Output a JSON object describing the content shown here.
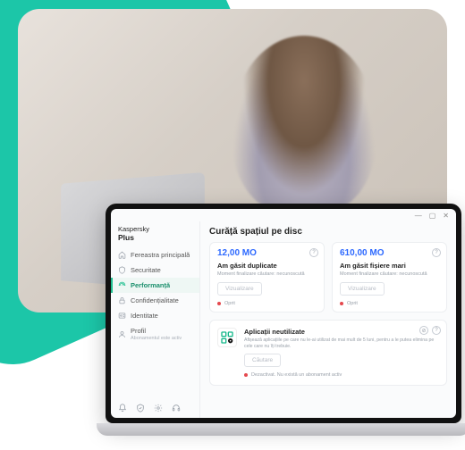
{
  "brand": {
    "line1": "Kaspersky",
    "line2": "Plus"
  },
  "window": {
    "min": "—",
    "max": "▢",
    "close": "✕"
  },
  "sidebar": {
    "items": [
      {
        "icon": "home-icon",
        "label": "Fereastra principală"
      },
      {
        "icon": "shield-icon",
        "label": "Securitate"
      },
      {
        "icon": "gauge-icon",
        "label": "Performanță"
      },
      {
        "icon": "lock-icon",
        "label": "Confidențialitate"
      },
      {
        "icon": "id-icon",
        "label": "Identitate"
      },
      {
        "icon": "user-icon",
        "label": "Profil",
        "sub": "Abonamentul este activ"
      }
    ],
    "bottom": {
      "bell": "bell-icon",
      "shield": "shield-check-icon",
      "gear": "gear-icon",
      "headset": "headset-icon"
    }
  },
  "main": {
    "title": "Curăță spațiul pe disc",
    "cards": {
      "duplicates": {
        "metric": "12,00 MO",
        "title": "Am găsit duplicate",
        "desc": "Moment finalizare căutare: necunoscută",
        "view_label": "Vizualizare",
        "status": "Oprit",
        "help_glyph": "?"
      },
      "large": {
        "metric": "610,00 MO",
        "title": "Am găsit fișiere mari",
        "desc": "Moment finalizare căutare: necunoscută",
        "view_label": "Vizualizare",
        "status": "Oprit",
        "help_glyph": "?"
      },
      "unused": {
        "title": "Aplicații neutilizate",
        "desc": "Afișează aplicațiile pe care nu le-ai utilizat de mai mult de 5 luni, pentru a le putea elimina pe cele care nu îți trebuie.",
        "search_label": "Căutare",
        "status": "Dezactivat. Nu există un abonament activ",
        "help_glyph": "?",
        "stop_glyph": "⊘"
      }
    }
  }
}
